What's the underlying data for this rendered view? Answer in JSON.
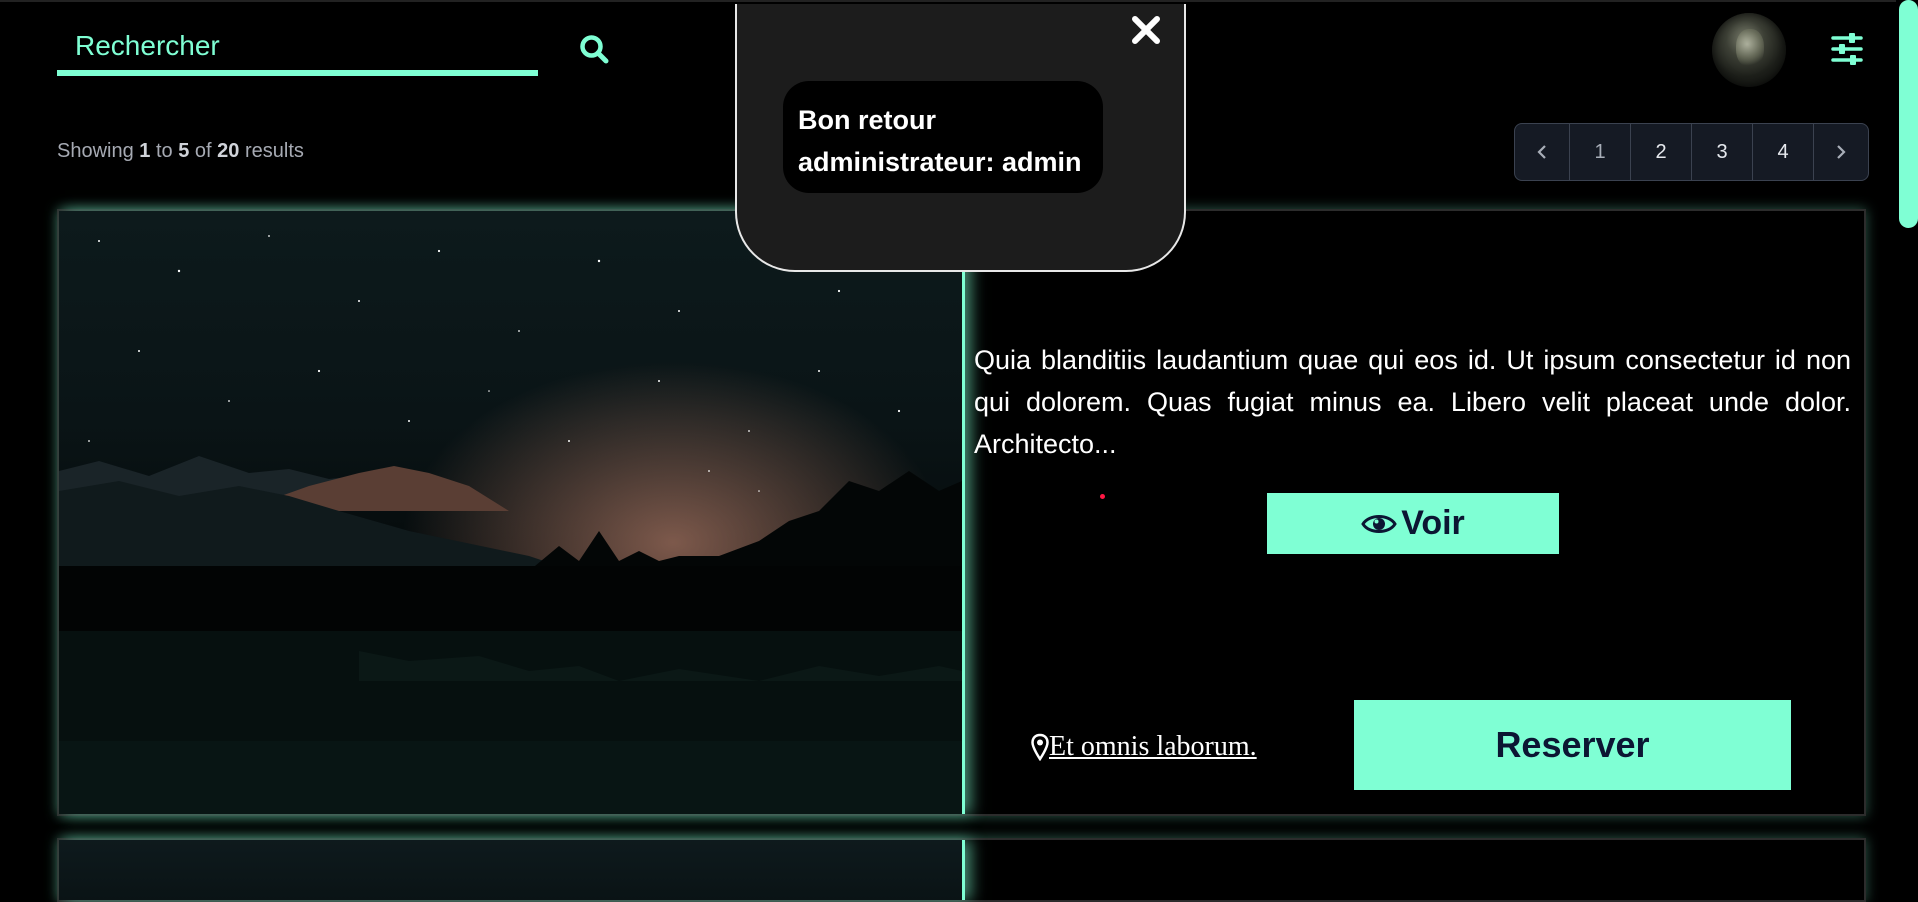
{
  "search": {
    "placeholder": "Rechercher"
  },
  "results": {
    "prefix": "Showing",
    "from": "1",
    "to_word": "to",
    "to": "5",
    "of_word": "of",
    "total": "20",
    "suffix": "results"
  },
  "pagination": {
    "pages": [
      "1",
      "2",
      "3",
      "4"
    ]
  },
  "card": {
    "description": "Quia blanditiis laudantium quae qui eos id. Ut ipsum consectetur id non qui dolorem. Quas fugiat minus ea. Libero velit placeat unde dolor. Architecto...",
    "voir_label": "Voir",
    "location_label": "Et omnis laborum.",
    "reserver_label": "Reserver"
  },
  "toast": {
    "message_line1": "Bon retour",
    "message_line2": "administrateur: admin"
  },
  "icons": {
    "search": "search-icon",
    "filter": "sliders-icon",
    "close": "close-icon",
    "eye": "eye-icon",
    "location": "map-marker-icon",
    "prev": "chevron-left-icon",
    "next": "chevron-right-icon"
  },
  "colors": {
    "accent": "#7fffd4",
    "button_text": "#0c1633",
    "toast_bg": "#1c1c1c"
  }
}
